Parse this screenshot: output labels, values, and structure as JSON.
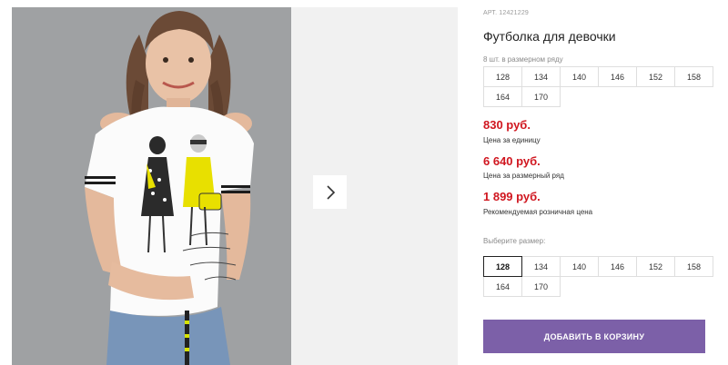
{
  "product": {
    "sku_label": "АРТ.",
    "sku": "12421229",
    "title": "Футболка для девочки",
    "pack_note": "8 шт. в размерном ряду",
    "pack_sizes": [
      "128",
      "134",
      "140",
      "146",
      "152",
      "158",
      "164",
      "170"
    ]
  },
  "prices": [
    {
      "value": "830 руб.",
      "label": "Цена за единицу"
    },
    {
      "value": "6 640 руб.",
      "label": "Цена за размерный ряд"
    },
    {
      "value": "1 899 руб.",
      "label": "Рекомендуемая розничная цена"
    }
  ],
  "size_selector": {
    "label": "Выберите размер:",
    "options": [
      "128",
      "134",
      "140",
      "146",
      "152",
      "158",
      "164",
      "170"
    ],
    "selected": "128"
  },
  "cart": {
    "add_label": "ДОБАВИТЬ В КОРЗИНУ"
  },
  "gallery": {
    "next_icon": "chevron-right-icon"
  },
  "colors": {
    "price": "#d0161f",
    "button": "#7c60a8",
    "border": "#dedede",
    "accent_print": "#e8e000"
  }
}
